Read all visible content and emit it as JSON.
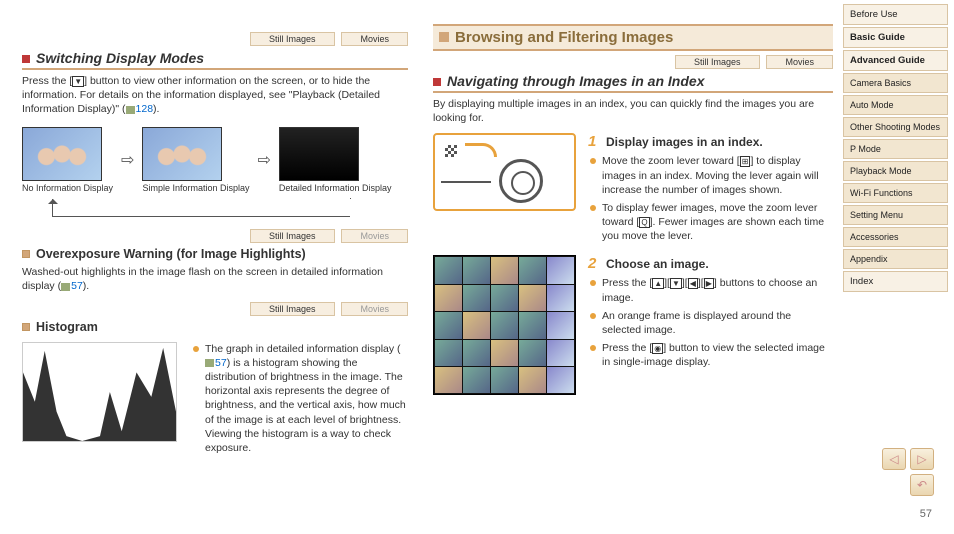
{
  "page_number": "57",
  "sidebar": {
    "items": [
      {
        "label": "Before Use",
        "bold": false,
        "sub": false
      },
      {
        "label": "Basic Guide",
        "bold": true,
        "sub": false
      },
      {
        "label": "Advanced Guide",
        "bold": true,
        "sub": false
      },
      {
        "label": "Camera Basics",
        "bold": false,
        "sub": true
      },
      {
        "label": "Auto Mode",
        "bold": false,
        "sub": true
      },
      {
        "label": "Other Shooting Modes",
        "bold": false,
        "sub": true
      },
      {
        "label": "P Mode",
        "bold": false,
        "sub": true
      },
      {
        "label": "Playback Mode",
        "bold": false,
        "sub": true
      },
      {
        "label": "Wi-Fi Functions",
        "bold": false,
        "sub": true
      },
      {
        "label": "Setting Menu",
        "bold": false,
        "sub": true
      },
      {
        "label": "Accessories",
        "bold": false,
        "sub": true
      },
      {
        "label": "Appendix",
        "bold": false,
        "sub": true
      },
      {
        "label": "Index",
        "bold": false,
        "sub": false
      }
    ]
  },
  "left": {
    "h2_switch": "Switching Display Modes",
    "tags": {
      "still": "Still Images",
      "movies": "Movies"
    },
    "switch_body_a": "Press the [",
    "switch_body_b": "] button to view other information on the screen, or to hide the information. For details on the information displayed, see \"Playback (Detailed Information Display)\" (",
    "switch_body_ref": "128",
    "switch_body_c": ").",
    "captions": [
      "No Information Display",
      "Simple Information Display",
      "Detailed Information Display"
    ],
    "h3_over": "Overexposure Warning (for Image Highlights)",
    "over_body_a": "Washed-out highlights in the image flash on the screen in detailed information display (",
    "over_ref": "57",
    "over_body_b": ").",
    "h3_hist": "Histogram",
    "hist_body_a": "The graph in detailed information display (",
    "hist_ref": "57",
    "hist_body_b": ") is a histogram showing the distribution of brightness in the image. The horizontal axis represents the degree of brightness, and the vertical axis, how much of the image is at each level of brightness. Viewing the histogram is a way to check exposure."
  },
  "right": {
    "h1": "Browsing and Filtering Images",
    "tags": {
      "still": "Still Images",
      "movies": "Movies"
    },
    "h2_nav": "Navigating through Images in an Index",
    "nav_body": "By displaying multiple images in an index, you can quickly find the images you are looking for.",
    "step1_title": "Display images in an index.",
    "step1_num": "1",
    "step1_b1_a": "Move the zoom lever toward [",
    "step1_b1_b": "] to display images in an index. Moving the lever again will increase the number of images shown.",
    "step1_b2_a": "To display fewer images, move the zoom lever toward [",
    "step1_b2_b": "]. Fewer images are shown each time you move the lever.",
    "step2_title": "Choose an image.",
    "step2_num": "2",
    "step2_b1_a": "Press the [",
    "step2_b1_b": "] buttons to choose an image.",
    "step2_b2": "An orange frame is displayed around the selected image.",
    "step2_b3_a": "Press the [",
    "step2_b3_b": "] button to view the selected image in single-image display."
  },
  "glyphs": {
    "down": "▼",
    "up": "▲",
    "left": "◀",
    "right": "▶",
    "func": "◉",
    "mag": "Q",
    "grid": "⊞"
  }
}
